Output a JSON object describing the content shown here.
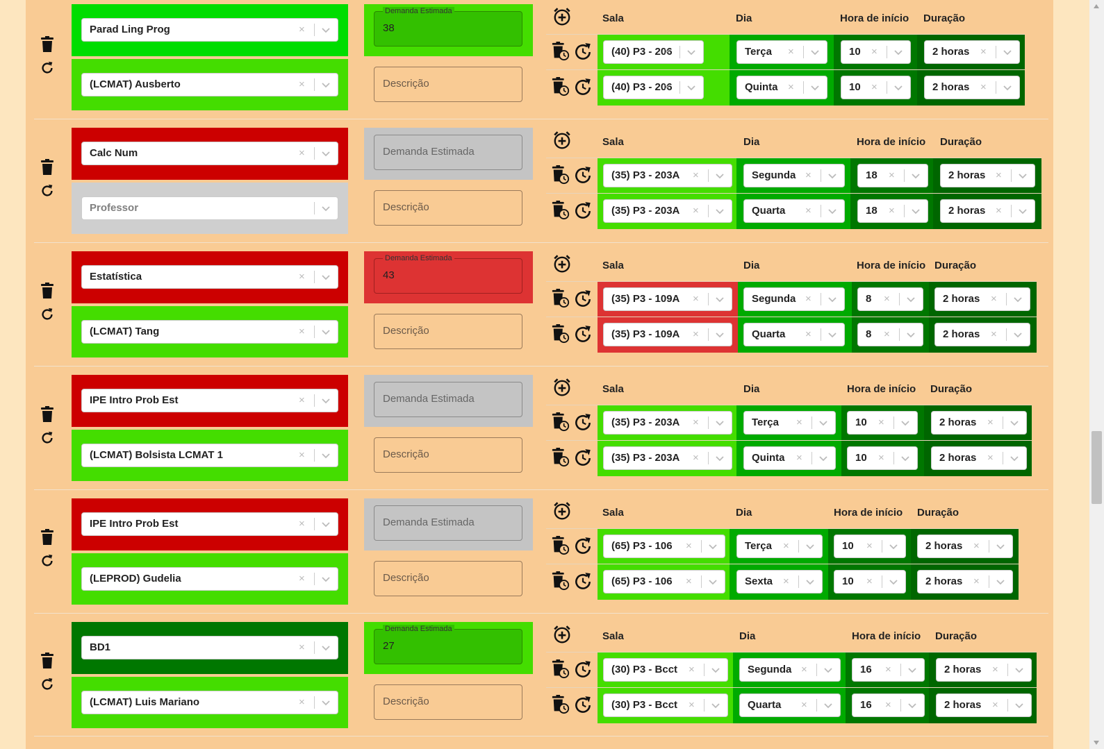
{
  "headers": {
    "sala": "Sala",
    "dia": "Dia",
    "hora": "Hora de início",
    "duracao": "Duração"
  },
  "placeholders": {
    "descricao": "Descrição",
    "demanda": "Demanda Estimada",
    "professor": "Professor"
  },
  "colors": {
    "page_bg": "#f9cb94",
    "outer_bg": "#fde6bf",
    "green_bright": "#00dd00",
    "green_mid": "#44dd00",
    "green_dark": "#00aa00",
    "green_darker": "#007700",
    "green_deep": "#006600",
    "red": "#cc0000",
    "red_light": "#dd3333",
    "gray": "#c4c4c4",
    "gray_light": "#cfcfcf",
    "demand_green": "#33c000"
  },
  "icons": {
    "delete": "trash-icon",
    "reset": "refresh-icon",
    "add_schedule": "alarm-plus-icon",
    "remove_schedule": "trash-clock-icon",
    "reset_schedule": "refresh-clock-icon"
  },
  "entries": [
    {
      "disciplina": "Parad Ling Prog",
      "professor": "(LCMAT) Ausberto",
      "demanda": "38",
      "demanda_label": "Demanda Estimada",
      "horarios": [
        {
          "sala": "(40) P3 - 206",
          "dia": "Terça",
          "hora": "10",
          "duracao": "2 horas"
        },
        {
          "sala": "(40) P3 - 206",
          "dia": "Quinta",
          "hora": "10",
          "duracao": "2 horas"
        }
      ]
    },
    {
      "disciplina": "Calc Num",
      "professor": "",
      "demanda": "",
      "demanda_label": "",
      "horarios": [
        {
          "sala": "(35) P3 - 203A",
          "dia": "Segunda",
          "hora": "18",
          "duracao": "2 horas"
        },
        {
          "sala": "(35) P3 - 203A",
          "dia": "Quarta",
          "hora": "18",
          "duracao": "2 horas"
        }
      ]
    },
    {
      "disciplina": "Estatística",
      "professor": "(LCMAT) Tang",
      "demanda": "43",
      "demanda_label": "Demanda Estimada",
      "horarios": [
        {
          "sala": "(35) P3 - 109A",
          "dia": "Segunda",
          "hora": "8",
          "duracao": "2 horas"
        },
        {
          "sala": "(35) P3 - 109A",
          "dia": "Quarta",
          "hora": "8",
          "duracao": "2 horas"
        }
      ]
    },
    {
      "disciplina": "IPE Intro Prob Est",
      "professor": "(LCMAT) Bolsista LCMAT 1",
      "demanda": "",
      "demanda_label": "",
      "horarios": [
        {
          "sala": "(35) P3 - 203A",
          "dia": "Terça",
          "hora": "10",
          "duracao": "2 horas"
        },
        {
          "sala": "(35) P3 - 203A",
          "dia": "Quinta",
          "hora": "10",
          "duracao": "2 horas"
        }
      ]
    },
    {
      "disciplina": "IPE Intro Prob Est",
      "professor": "(LEPROD) Gudelia",
      "demanda": "",
      "demanda_label": "",
      "horarios": [
        {
          "sala": "(65) P3 - 106",
          "dia": "Terça",
          "hora": "10",
          "duracao": "2 horas"
        },
        {
          "sala": "(65) P3 - 106",
          "dia": "Sexta",
          "hora": "10",
          "duracao": "2 horas"
        }
      ]
    },
    {
      "disciplina": "BD1",
      "professor": "(LCMAT) Luis Mariano",
      "demanda": "27",
      "demanda_label": "Demanda Estimada",
      "horarios": [
        {
          "sala": "(30) P3 - Bcct",
          "dia": "Segunda",
          "hora": "16",
          "duracao": "2 horas"
        },
        {
          "sala": "(30) P3 - Bcct",
          "dia": "Quarta",
          "hora": "16",
          "duracao": "2 horas"
        }
      ]
    }
  ]
}
